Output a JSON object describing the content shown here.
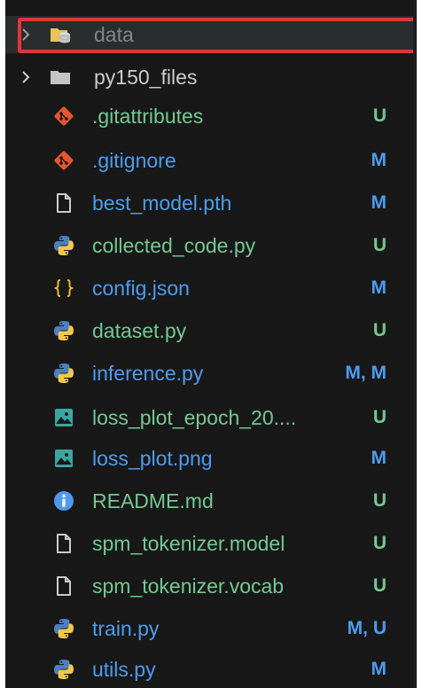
{
  "explorer": {
    "items": [
      {
        "type": "folder",
        "label": "data",
        "badge": "",
        "icon": "database-folder-icon",
        "expanded": false,
        "dimmed": true,
        "selected": true
      },
      {
        "type": "folder",
        "label": "py150_files",
        "badge": "",
        "icon": "folder-icon",
        "expanded": false
      },
      {
        "type": "file",
        "label": ".gitattributes",
        "badge": "U",
        "icon": "git-icon"
      },
      {
        "type": "file",
        "label": ".gitignore",
        "badge": "M",
        "icon": "git-icon"
      },
      {
        "type": "file",
        "label": "best_model.pth",
        "badge": "M",
        "icon": "file-icon"
      },
      {
        "type": "file",
        "label": "collected_code.py",
        "badge": "U",
        "icon": "python-icon"
      },
      {
        "type": "file",
        "label": "config.json",
        "badge": "M",
        "icon": "json-braces-icon"
      },
      {
        "type": "file",
        "label": "dataset.py",
        "badge": "U",
        "icon": "python-icon"
      },
      {
        "type": "file",
        "label": "inference.py",
        "badge": "M, M",
        "icon": "python-icon"
      },
      {
        "type": "file",
        "label": "loss_plot_epoch_20....",
        "badge": "U",
        "icon": "image-icon"
      },
      {
        "type": "file",
        "label": "loss_plot.png",
        "badge": "M",
        "icon": "image-icon"
      },
      {
        "type": "file",
        "label": "README.md",
        "badge": "U",
        "icon": "info-icon"
      },
      {
        "type": "file",
        "label": "spm_tokenizer.model",
        "badge": "U",
        "icon": "file-icon"
      },
      {
        "type": "file",
        "label": "spm_tokenizer.vocab",
        "badge": "U",
        "icon": "file-icon"
      },
      {
        "type": "file",
        "label": "train.py",
        "badge": "M, U",
        "icon": "python-icon"
      },
      {
        "type": "file",
        "label": "utils.py",
        "badge": "M",
        "icon": "python-icon"
      }
    ]
  },
  "colors": {
    "background": "#181818",
    "modified": "#4d9cf0",
    "untracked": "#73c991",
    "highlight_border": "#e5343a",
    "folder_text": "#cccccc",
    "dimmed_text": "#858585"
  }
}
